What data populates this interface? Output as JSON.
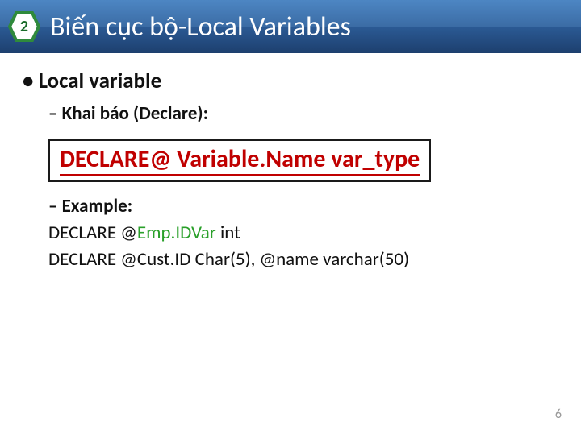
{
  "badge": {
    "number": "2"
  },
  "title": "Biến cục bộ-Local Variables",
  "bullets": {
    "lvl1": "Local variable",
    "declare": "Khai báo (Declare):",
    "syntax": "DECLARE@ Variable.Name var_type",
    "example_label": "Example",
    "ex1_a": "DECLARE @",
    "ex1_b": "Emp.IDVar",
    "ex1_c": " int",
    "ex2": "DECLARE @Cust.ID Char(5), @name varchar(50)"
  },
  "page": "6"
}
